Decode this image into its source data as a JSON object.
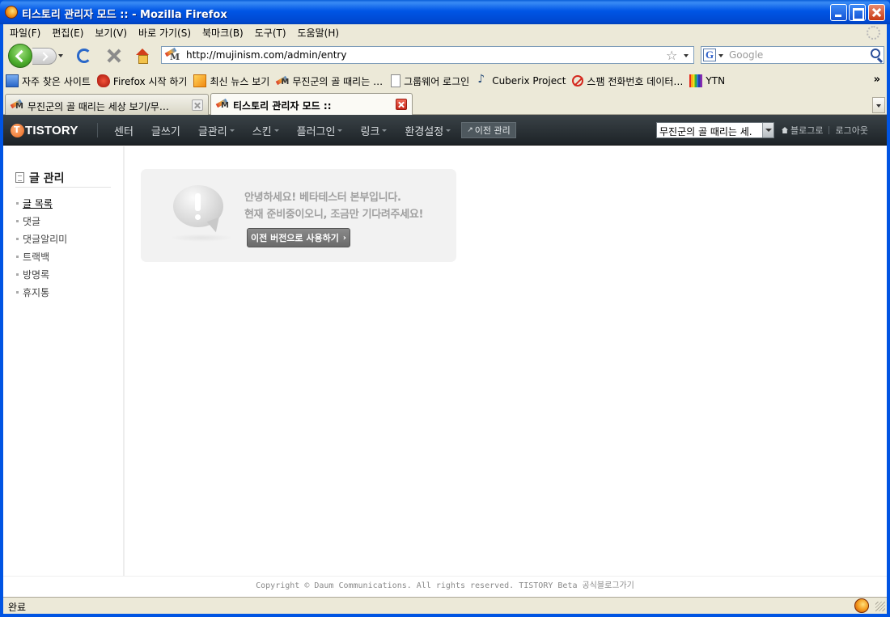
{
  "window": {
    "title": "티스토리 관리자 모드 :: - Mozilla Firefox"
  },
  "menubar": {
    "items": [
      "파일(F)",
      "편집(E)",
      "보기(V)",
      "바로 가기(S)",
      "북마크(B)",
      "도구(T)",
      "도움말(H)"
    ]
  },
  "navbar": {
    "url": "http://mujinism.com/admin/entry",
    "search_placeholder": "Google"
  },
  "bookmarks": {
    "items": [
      {
        "label": "자주 찾은 사이트",
        "icon": "smart-folder-icon"
      },
      {
        "label": "Firefox 시작 하기",
        "icon": "firefox-start-icon"
      },
      {
        "label": "최신 뉴스 보기",
        "icon": "rss-icon"
      },
      {
        "label": "무진군의 골 때리는 …",
        "icon": "mujinism-favicon"
      },
      {
        "label": "그룹웨어 로그인",
        "icon": "page-icon"
      },
      {
        "label": "Cuberix Project",
        "icon": "music-note-icon"
      },
      {
        "label": "스팸 전화번호 데이터…",
        "icon": "no-spam-icon"
      },
      {
        "label": "YTN",
        "icon": "ytn-icon"
      }
    ],
    "overflow": "»"
  },
  "tabs": [
    {
      "label": "무진군의 골 때리는 세상 보기/무…",
      "active": false
    },
    {
      "label": "티스토리 관리자 모드 ::",
      "active": true
    }
  ],
  "tistory": {
    "logo": "TISTORY",
    "nav": [
      {
        "label": "센터",
        "dropdown": false
      },
      {
        "label": "글쓰기",
        "dropdown": false
      },
      {
        "label": "글관리",
        "dropdown": true
      },
      {
        "label": "스킨",
        "dropdown": true
      },
      {
        "label": "플러그인",
        "dropdown": true
      },
      {
        "label": "링크",
        "dropdown": true
      },
      {
        "label": "환경설정",
        "dropdown": true
      }
    ],
    "old_admin": "이전 관리",
    "blog_select": "무진군의 골 때리는 세.",
    "blog_link": "블로그로",
    "logout": "로그아웃"
  },
  "sidebar": {
    "title": "글 관리",
    "items": [
      {
        "label": "글 목록",
        "active": true
      },
      {
        "label": "댓글",
        "active": false
      },
      {
        "label": "댓글알리미",
        "active": false
      },
      {
        "label": "트랙백",
        "active": false
      },
      {
        "label": "방명록",
        "active": false
      },
      {
        "label": "휴지통",
        "active": false
      }
    ]
  },
  "notice": {
    "line1": "안녕하세요! 베타테스터 본부입니다.",
    "line2": "현재 준비중이오니, 조금만 기다려주세요!",
    "button": "이전 버전으로 사용하기"
  },
  "footer": {
    "text": "Copyright © Daum Communications. All rights reserved. TISTORY Beta 공식블로그가기"
  },
  "statusbar": {
    "text": "완료"
  }
}
